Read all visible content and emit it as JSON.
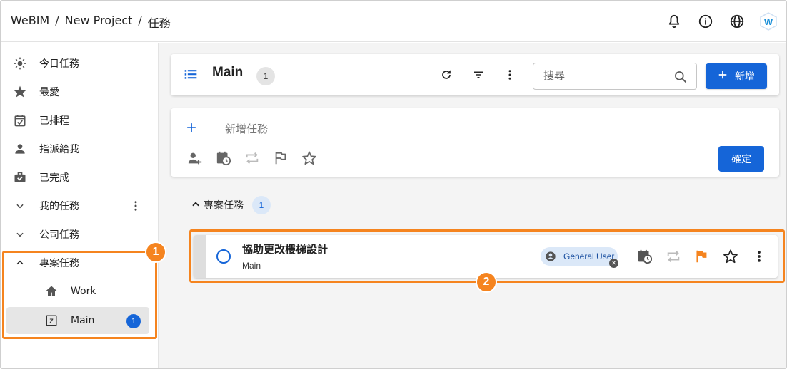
{
  "breadcrumb": [
    "WeBIM",
    "New Project",
    "任務"
  ],
  "topbar": {
    "icons": [
      "bell-icon",
      "info-icon",
      "globe-icon",
      "webim-logo"
    ],
    "logo_letter": "W"
  },
  "sidebar": {
    "items": [
      {
        "label": "今日任務",
        "icon": "sun-icon"
      },
      {
        "label": "最愛",
        "icon": "star-icon"
      },
      {
        "label": "已排程",
        "icon": "calendar-check-icon"
      },
      {
        "label": "指派給我",
        "icon": "person-icon"
      },
      {
        "label": "已完成",
        "icon": "briefcase-check-icon"
      },
      {
        "label": "我的任務",
        "icon": "chevron-down-icon"
      },
      {
        "label": "公司任務",
        "icon": "chevron-down-icon"
      },
      {
        "label": "專案任務",
        "icon": "chevron-up-icon"
      }
    ],
    "sub_items": [
      {
        "label": "Work",
        "icon": "home-icon"
      },
      {
        "label": "Main",
        "icon": "z-box-icon",
        "count": "1"
      }
    ]
  },
  "header": {
    "title": "Main",
    "count": "1",
    "search_placeholder": "搜尋",
    "add_label": "新增"
  },
  "new_task": {
    "placeholder": "新增任務",
    "confirm_label": "確定",
    "tools": [
      "assign-user-icon",
      "schedule-icon",
      "repeat-icon",
      "flag-icon",
      "star-icon"
    ]
  },
  "group": {
    "label": "專案任務",
    "count": "1"
  },
  "task": {
    "name": "協助更改樓梯設計",
    "project": "Main",
    "assignee": "General User",
    "flag_color": "#f5841f"
  },
  "callouts": [
    "1",
    "2"
  ],
  "colors": {
    "accent": "#1565d8",
    "highlight": "#f5841f"
  }
}
